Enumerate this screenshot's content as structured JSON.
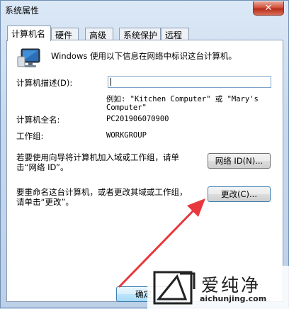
{
  "window": {
    "title": "系统属性",
    "close_icon": "close-icon"
  },
  "tabs": [
    {
      "label": "计算机名",
      "active": true
    },
    {
      "label": "硬件",
      "active": false
    },
    {
      "label": "高级",
      "active": false
    },
    {
      "label": "系统保护",
      "active": false
    },
    {
      "label": "远程",
      "active": false
    }
  ],
  "panel": {
    "intro": "Windows 使用以下信息在网络中标识这台计算机。",
    "desc_label": "计算机描述(D):",
    "desc_value": "",
    "example_line1": "例如: \"Kitchen Computer\" 或 \"Mary's",
    "example_line2": "Computer\"",
    "fullname_label": "计算机全名:",
    "fullname_value": "PC201906070900",
    "workgroup_label": "工作组:",
    "workgroup_value": "WORKGROUP",
    "netid_text_line1": "若要使用向导将计算机加入域或工作组，请单",
    "netid_text_line2": "击“网络 ID”。",
    "netid_button": "网络 ID(N)...",
    "rename_text_line1": "要重命名这台计算机，或者更改其域或工作组，",
    "rename_text_line2": "请单击“更改”。",
    "change_button": "更改(C)..."
  },
  "footer": {
    "ok_button": "确定"
  },
  "watermark": {
    "text": "爱纯净",
    "url": "aichunjing.com"
  },
  "colors": {
    "arrow": "#e8383d",
    "accent": "#3c7fb1"
  }
}
